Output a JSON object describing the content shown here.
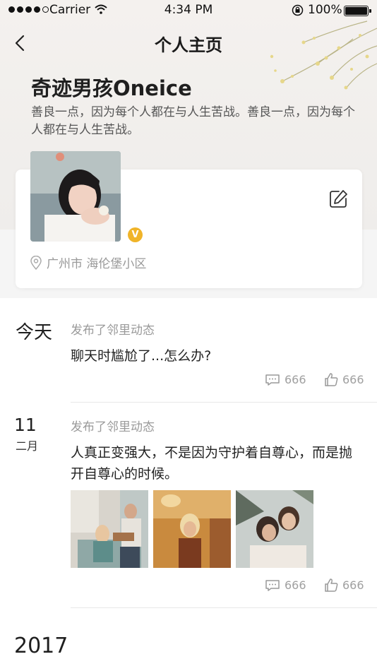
{
  "status_bar": {
    "carrier": "Carrier",
    "time": "4:34 PM",
    "battery": "100%"
  },
  "nav": {
    "title": "个人主页"
  },
  "profile": {
    "name": "奇迹男孩Oneice",
    "bio": "善良一点，因为每个人都在与人生苦战。善良一点，因为每个人都在与人生苦战。",
    "verified_badge": "V",
    "location": "广州市 海伦堡小区"
  },
  "feed": [
    {
      "date_label": "今天",
      "action": "发布了邻里动态",
      "text": "聊天时尴尬了...怎么办?",
      "comments": "666",
      "likes": "666"
    },
    {
      "date_day": "11",
      "date_month": "二月",
      "action": "发布了邻里动态",
      "text": "人真正变强大，不是因为守护着自尊心，而是抛开自尊心的时候。",
      "comments": "666",
      "likes": "666"
    }
  ],
  "year_label": "2017",
  "icons": [
    "back-chevron-icon",
    "wifi-icon",
    "lock-rotation-icon",
    "battery-icon",
    "edit-icon",
    "location-pin-icon",
    "comment-icon",
    "thumbs-up-icon"
  ],
  "colors": {
    "badge": "#f0b429",
    "muted_text": "#999999",
    "header_bg": "#f2efec"
  }
}
